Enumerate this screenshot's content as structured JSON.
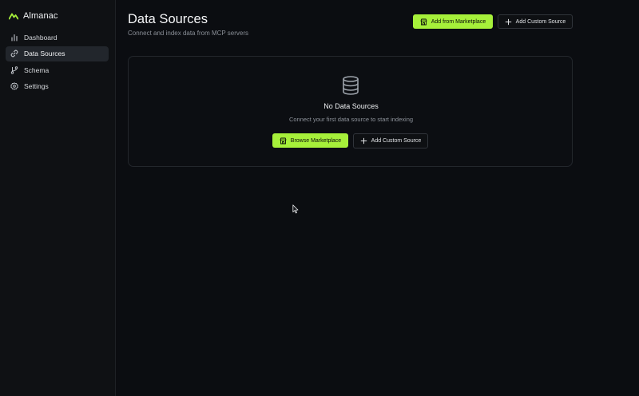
{
  "sidebar": {
    "brand": "Almanac",
    "items": [
      {
        "label": "Dashboard",
        "icon": "bar-chart-icon",
        "active": false
      },
      {
        "label": "Data Sources",
        "icon": "link-icon",
        "active": true
      },
      {
        "label": "Schema",
        "icon": "branch-icon",
        "active": false
      },
      {
        "label": "Settings",
        "icon": "gear-icon",
        "active": false
      }
    ]
  },
  "header": {
    "title": "Data Sources",
    "subtitle": "Connect and index data from MCP servers",
    "marketplace_button": "Add from Marketplace",
    "custom_button": "Add Custom Source"
  },
  "empty_state": {
    "title": "No Data Sources",
    "description": "Connect your first data source to start indexing",
    "browse_button": "Browse Marketplace",
    "custom_button": "Add Custom Source"
  },
  "colors": {
    "accent": "#a6f03a",
    "background": "#0b0d11",
    "sidebar": "#0f1114"
  }
}
